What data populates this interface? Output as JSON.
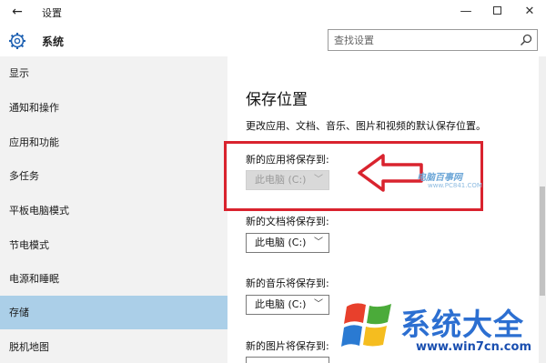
{
  "window": {
    "title": "设置",
    "back_icon": "back-arrow-icon",
    "controls": {
      "minimize": "—",
      "close": "✕"
    }
  },
  "header": {
    "title": "系统",
    "icon": "gear-icon",
    "search_placeholder": "查找设置"
  },
  "sidebar": {
    "items": [
      {
        "label": "显示"
      },
      {
        "label": "通知和操作"
      },
      {
        "label": "应用和功能"
      },
      {
        "label": "多任务"
      },
      {
        "label": "平板电脑模式"
      },
      {
        "label": "节电模式"
      },
      {
        "label": "电源和睡眠"
      },
      {
        "label": "存储",
        "active": true
      },
      {
        "label": "脱机地图"
      }
    ]
  },
  "main": {
    "title": "保存位置",
    "description": "更改应用、文档、音乐、图片和视频的默认保存位置。",
    "fields": [
      {
        "label": "新的应用将保存到:",
        "value": "此电脑 (C:)",
        "disabled": true
      },
      {
        "label": "新的文档将保存到:",
        "value": "此电脑 (C:)"
      },
      {
        "label": "新的音乐将保存到:",
        "value": "此电脑 (C:)"
      },
      {
        "label": "新的图片将保存到:",
        "value": ""
      }
    ]
  },
  "watermarks": {
    "small_site": "电脑百事网",
    "small_url": "www.PC841.COM",
    "brand": "系统大全",
    "brand_url": "www.win7cn.com"
  },
  "colors": {
    "sidebar_bg": "#f2f2f2",
    "active_item": "#abcfe8",
    "highlight": "#d9232e",
    "brand_blue": "#2c6fd1"
  }
}
